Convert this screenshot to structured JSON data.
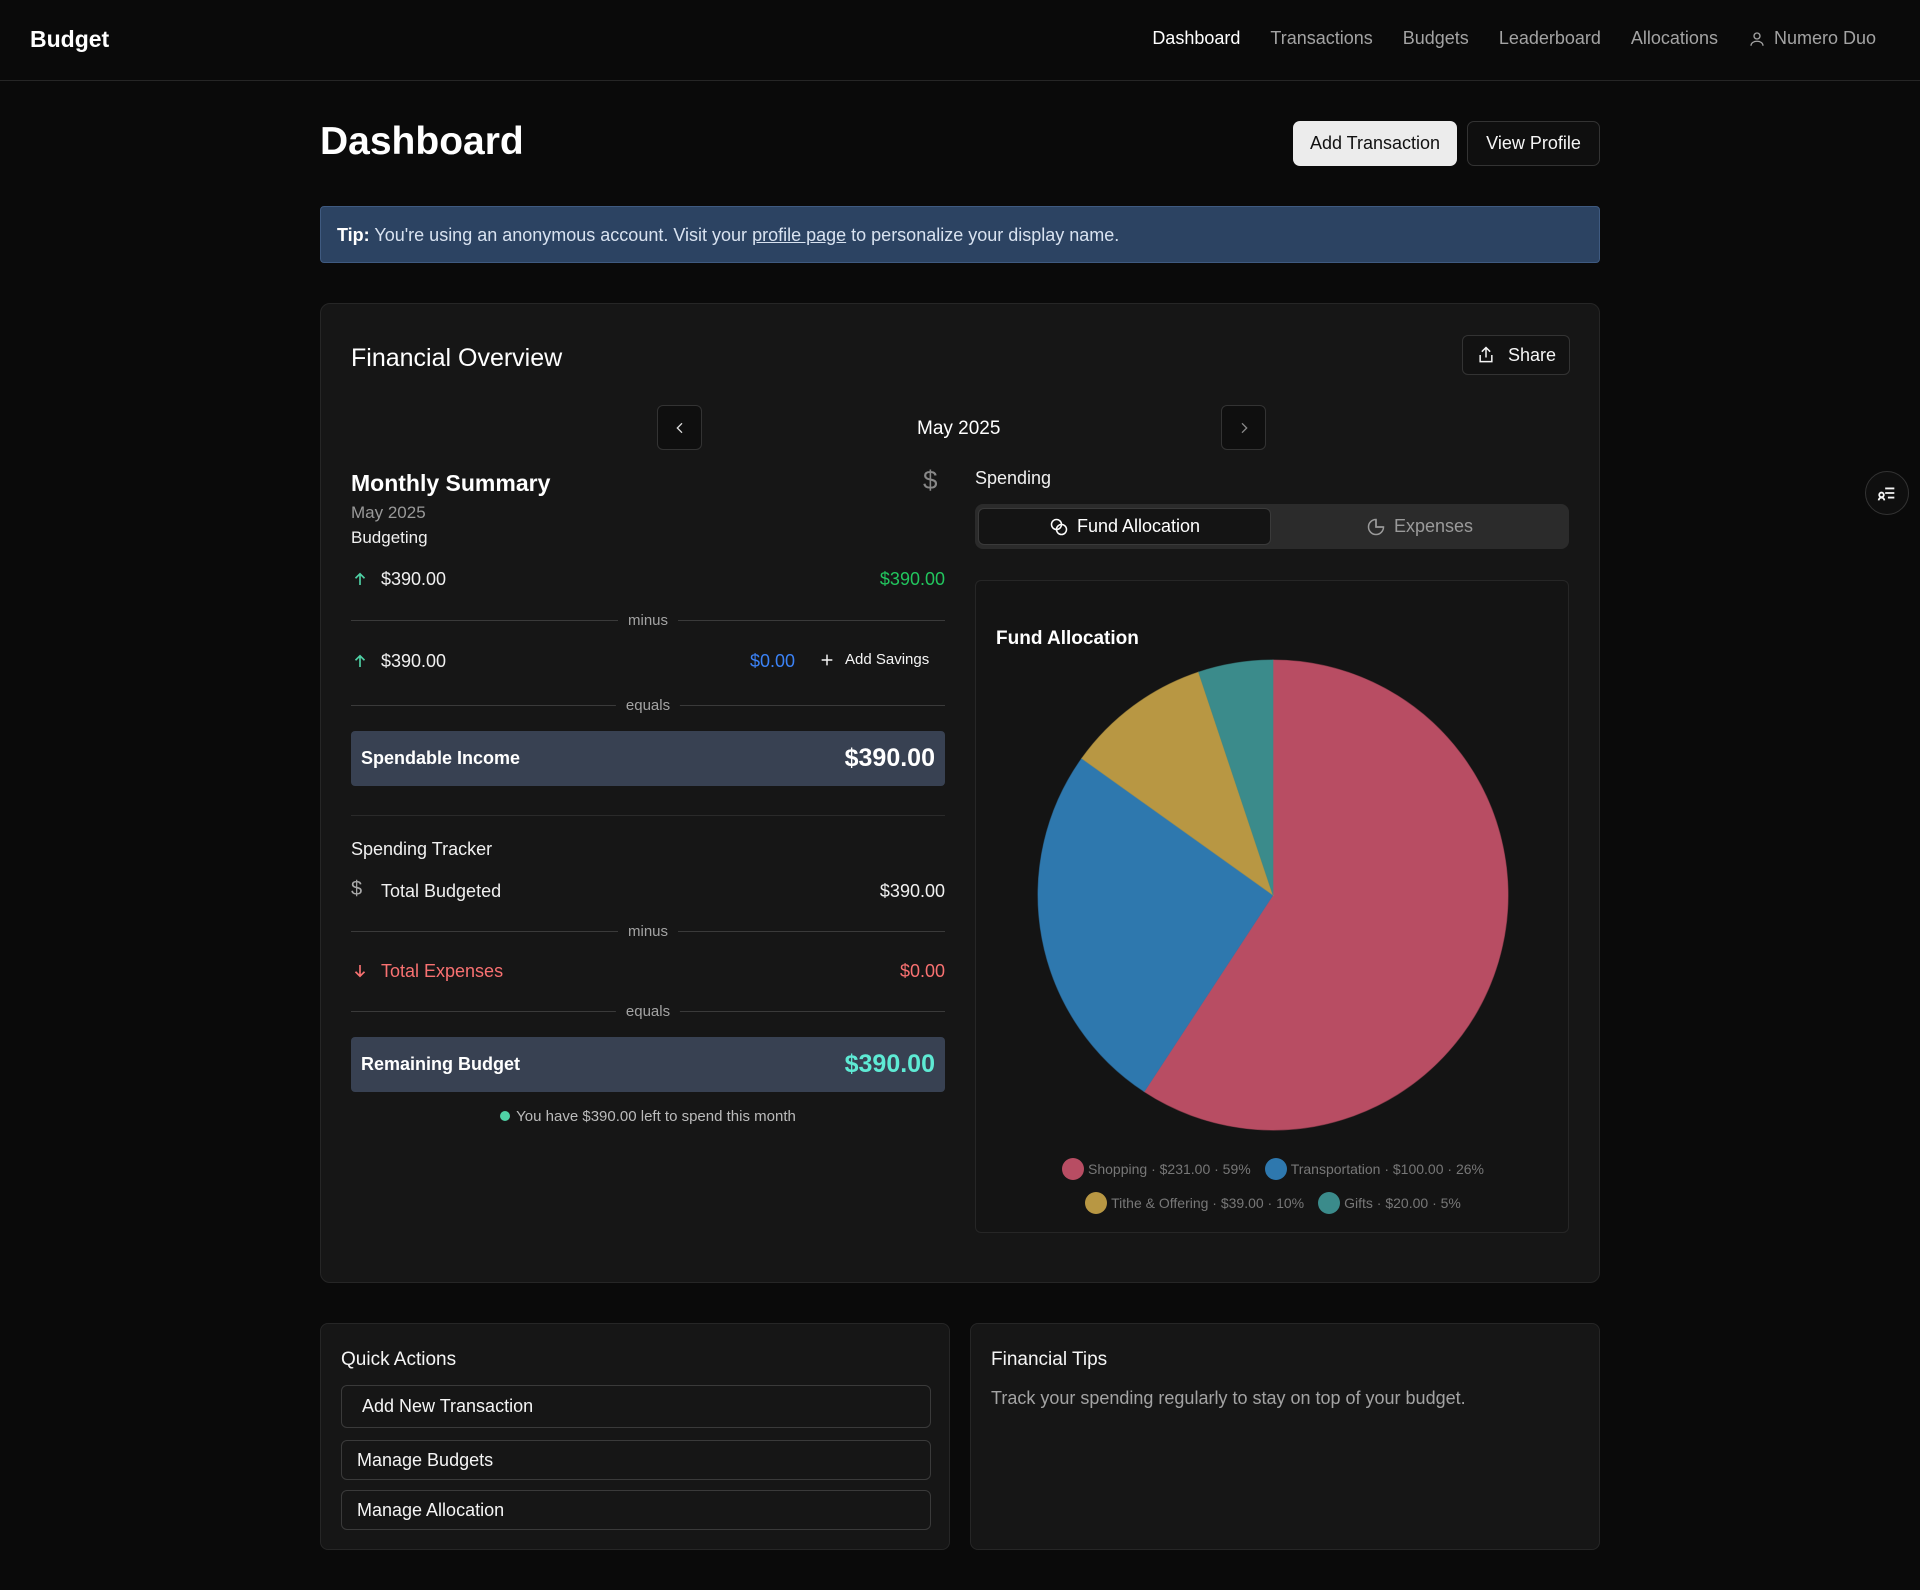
{
  "nav": {
    "brand": "Budget",
    "links": [
      "Dashboard",
      "Transactions",
      "Budgets",
      "Leaderboard",
      "Allocations"
    ],
    "user": "Numero Duo"
  },
  "header": {
    "title": "Dashboard",
    "add_transaction": "Add Transaction",
    "view_profile": "View Profile"
  },
  "tip": {
    "label": "Tip:",
    "before": "You're using an anonymous account. Visit your",
    "link": "profile page",
    "after": "to personalize your display name."
  },
  "overview": {
    "title": "Financial Overview",
    "share": "Share",
    "month": "May 2025"
  },
  "summary": {
    "title": "Monthly Summary",
    "month": "May 2025",
    "subtitle": "Budgeting",
    "income_label": "$390.00",
    "income_value": "$390.00",
    "minus": "minus",
    "savings_label": "$390.00",
    "savings_value": "$0.00",
    "add_savings": "Add Savings",
    "equals": "equals",
    "spendable_label": "Spendable Income",
    "spendable_value": "$390.00"
  },
  "tracker": {
    "title": "Spending Tracker",
    "budgeted_label": "Total Budgeted",
    "budgeted_value": "$390.00",
    "minus": "minus",
    "expenses_label": "Total Expenses",
    "expenses_value": "$0.00",
    "equals": "equals",
    "remaining_label": "Remaining Budget",
    "remaining_value": "$390.00",
    "message": "You have $390.00 left to spend this month"
  },
  "spending": {
    "label": "Spending",
    "tab_fund": "Fund Allocation",
    "tab_expenses": "Expenses"
  },
  "chart_data": {
    "type": "pie",
    "title": "Fund Allocation",
    "categories": [
      "Shopping",
      "Transportation",
      "Tithe & Offering",
      "Gifts"
    ],
    "values": [
      231.0,
      100.0,
      39.0,
      20.0
    ],
    "percents": [
      59,
      26,
      10,
      5
    ],
    "colors": [
      "#b84d63",
      "#2e78ae",
      "#b89743",
      "#3b8b8b"
    ],
    "legend_labels": [
      "Shopping · $231.00 · 59%",
      "Transportation · $100.00 · 26%",
      "Tithe & Offering · $39.00 · 10%",
      "Gifts · $20.00 · 5%"
    ]
  },
  "quick_actions": {
    "title": "Quick Actions",
    "items": [
      "Add New Transaction",
      "Manage Budgets",
      "Manage Allocation"
    ]
  },
  "tips": {
    "title": "Financial Tips",
    "text": "Track your spending regularly to stay on top of your budget."
  },
  "colors": {
    "green": "#22c55e",
    "teal": "#5eead4",
    "blue": "#3b82f6",
    "red": "#f87171",
    "tip_bg": "#2c4362",
    "total_bg": "#384152"
  }
}
